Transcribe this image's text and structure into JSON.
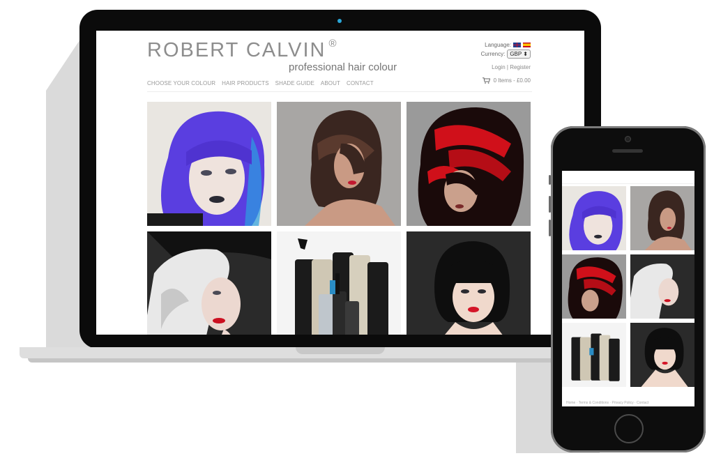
{
  "brand": {
    "name": "ROBERT CALVIN",
    "registered_mark": "®",
    "tagline": "professional hair colour"
  },
  "header": {
    "language_label": "Language:",
    "currency_label": "Currency:",
    "currency_value": "GBP ⬍",
    "login": "Login",
    "separator": "|",
    "register": "Register",
    "cart": "0 Items - £0.00"
  },
  "nav": [
    "CHOOSE YOUR COLOUR",
    "HAIR PRODUCTS",
    "SHADE GUIDE",
    "ABOUT",
    "CONTACT"
  ],
  "gallery": [
    {
      "icon": "purple-bob-portrait"
    },
    {
      "icon": "brunette-bob-portrait"
    },
    {
      "icon": "red-streak-portrait"
    },
    {
      "icon": "platinum-waves-portrait"
    },
    {
      "icon": "product-bottles"
    },
    {
      "icon": "black-bob-portrait"
    }
  ],
  "phone_footer": "Home · Terms & Conditions · Privacy Policy · Contact",
  "colors": {
    "logo_grey": "#8d8d8d",
    "device_black": "#0b0b0b",
    "shadow_grey": "#dadada",
    "purple_hair": "#5a3ee0",
    "red_hair": "#d0101a",
    "camera_blue": "#2aa6d8"
  }
}
